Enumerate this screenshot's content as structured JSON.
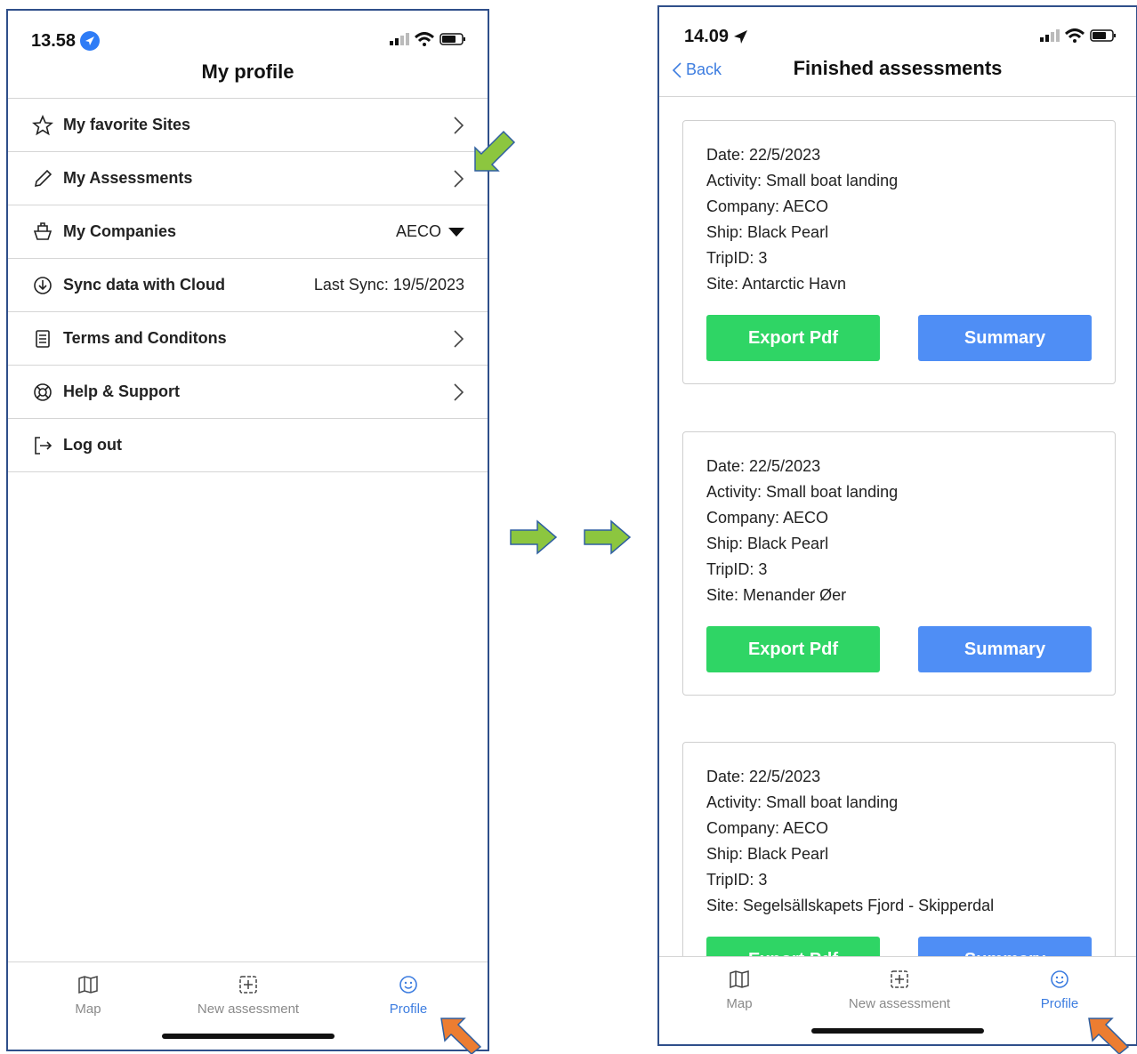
{
  "left": {
    "time": "13.58",
    "title": "My profile",
    "menu": [
      {
        "label": "My favorite Sites",
        "right": "",
        "icon": "star-icon"
      },
      {
        "label": "My Assessments",
        "right": "",
        "icon": "pencil-icon"
      },
      {
        "label": "My Companies",
        "right": "AECO",
        "icon": "ship-icon"
      },
      {
        "label": "Sync data with Cloud",
        "right": "Last Sync: 19/5/2023",
        "icon": "sync-icon"
      },
      {
        "label": "Terms and Conditons",
        "right": "",
        "icon": "document-icon"
      },
      {
        "label": "Help & Support",
        "right": "",
        "icon": "lifebuoy-icon"
      },
      {
        "label": "Log out",
        "right": "",
        "icon": "logout-icon"
      }
    ],
    "tabs": {
      "map": "Map",
      "new": "New assessment",
      "profile": "Profile"
    }
  },
  "right": {
    "time": "14.09",
    "back": "Back",
    "title": "Finished assessments",
    "cards": [
      {
        "date": "Date:  22/5/2023",
        "activity": "Activity:  Small boat landing",
        "company": "Company:  AECO",
        "ship": "Ship:  Black Pearl",
        "trip": "TripID:  3",
        "site": "Site:  Antarctic Havn",
        "export": "Export Pdf",
        "summary": "Summary"
      },
      {
        "date": "Date:  22/5/2023",
        "activity": "Activity:  Small boat landing",
        "company": "Company:  AECO",
        "ship": "Ship:  Black Pearl",
        "trip": "TripID:  3",
        "site": "Site:  Menander Øer",
        "export": "Export Pdf",
        "summary": "Summary"
      },
      {
        "date": "Date:  22/5/2023",
        "activity": "Activity:  Small boat landing",
        "company": "Company:  AECO",
        "ship": "Ship:  Black Pearl",
        "trip": "TripID:  3",
        "site": "Site:  Segelsällskapets Fjord - Skipperdal",
        "export": "Export Pdf",
        "summary": "Summary"
      }
    ],
    "tabs": {
      "map": "Map",
      "new": "New assessment",
      "profile": "Profile"
    }
  },
  "colors": {
    "accent": "#3d7de0",
    "export": "#2fd565",
    "summary": "#4f8ef5",
    "annotation_green": "#8cc63f",
    "annotation_orange": "#ec7d31"
  }
}
